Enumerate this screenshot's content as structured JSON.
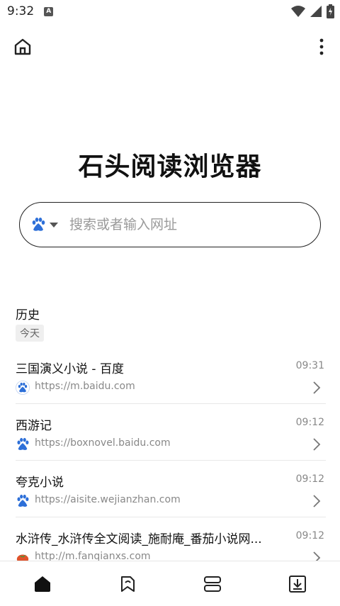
{
  "status_bar": {
    "time": "9:32",
    "indicator": "A"
  },
  "app": {
    "title": "石头阅读浏览器"
  },
  "search": {
    "placeholder": "搜索或者输入网址",
    "engine_icon": "baidu-paw-icon"
  },
  "history": {
    "title": "历史",
    "day_label": "今天",
    "items": [
      {
        "title": "三国演义小说 - 百度",
        "url": "https://m.baidu.com",
        "time": "09:31",
        "favicon": "baidu-paw-icon"
      },
      {
        "title": "西游记",
        "url": "https://boxnovel.baidu.com",
        "time": "09:12",
        "favicon": "baidu-paw-icon"
      },
      {
        "title": "夸克小说",
        "url": "https://aisite.wejianzhan.com",
        "time": "09:12",
        "favicon": "baidu-paw-icon"
      },
      {
        "title": "水浒传_水浒传全文阅读_施耐庵_番茄小说网...",
        "url": "http://m.fanqianxs.com",
        "time": "09:12",
        "favicon": "tomato-icon"
      }
    ]
  },
  "bottom_nav": {
    "items": [
      "home-icon",
      "bookmark-icon",
      "tabs-icon",
      "download-icon"
    ]
  },
  "colors": {
    "accent": "#2d6fd8",
    "text": "#1a1a1a",
    "muted": "#888888"
  }
}
